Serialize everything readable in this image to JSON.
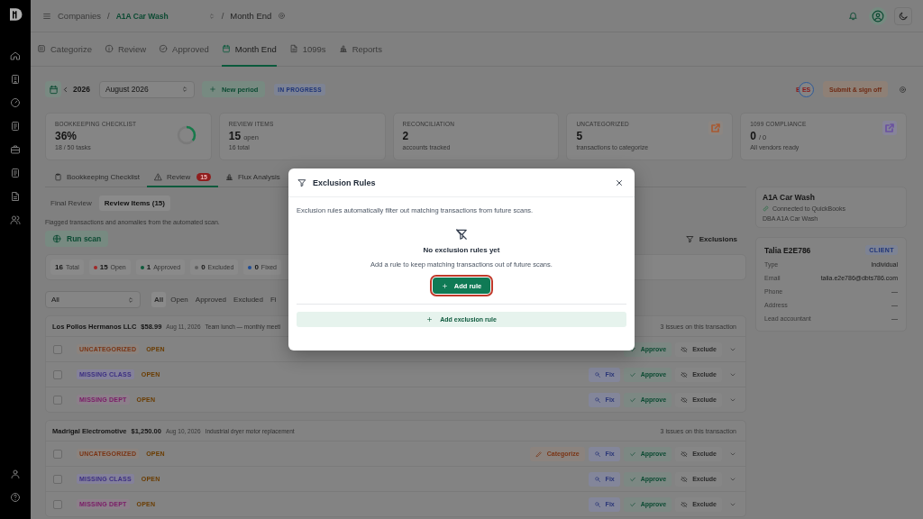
{
  "breadcrumb": [
    {
      "text": "Companies",
      "kind": "link"
    },
    {
      "text": "/",
      "kind": "sep"
    },
    {
      "text": "A1A Car Wash",
      "kind": "company"
    },
    {
      "text": "/",
      "kind": "sep"
    },
    {
      "text": "Month End",
      "kind": "page"
    }
  ],
  "tabs": [
    {
      "label": "Categorize",
      "kind": "categorize",
      "selected": false
    },
    {
      "label": "Review",
      "kind": "review",
      "selected": false
    },
    {
      "label": "Approved",
      "kind": "approved",
      "selected": false
    },
    {
      "label": "Month End",
      "kind": "calendar",
      "selected": true
    },
    {
      "label": "1099s",
      "kind": "file",
      "selected": false
    },
    {
      "label": "Reports",
      "kind": "chart",
      "selected": false
    }
  ],
  "period": {
    "year": "2026",
    "month": "August 2026",
    "new_button": "New period",
    "status": "IN PROGRESS"
  },
  "signoff": {
    "avatars": [
      "E",
      "ES"
    ],
    "button": "Submit & sign off"
  },
  "stats": [
    {
      "label": "BOOKKEEPING CHECKLIST",
      "value": "36%",
      "sub": "18 / 50 tasks",
      "kind": "ring",
      "level": 0.36
    },
    {
      "label": "REVIEW ITEMS",
      "value": "15",
      "unit": "open",
      "sub": "16 total",
      "kind": "plain"
    },
    {
      "label": "RECONCILIATION",
      "value": "2",
      "sub": "accounts tracked",
      "kind": "plain"
    },
    {
      "label": "UNCATEGORIZED",
      "value": "5",
      "sub": "transactions to categorize",
      "kind": "link",
      "color": "#a85a32"
    },
    {
      "label": "1099 COMPLIANCE",
      "value": "0",
      "unit": "/ 0",
      "sub": "All vendors ready",
      "kind": "link",
      "color": "#6a52a0"
    }
  ],
  "subtabs": [
    {
      "label": "Bookkeeping Checklist",
      "kind": "checklist",
      "selected": false
    },
    {
      "label": "Review",
      "kind": "review",
      "badge": "15",
      "selected": true
    },
    {
      "label": "Flux Analysis",
      "kind": "flux",
      "selected": false
    }
  ],
  "segments": [
    {
      "label": "Final Review",
      "selected": false
    },
    {
      "label": "Review Items (15)",
      "selected": true
    }
  ],
  "caption": "Flagged transactions and anomalies from the automated scan.",
  "run_scan": "Run scan",
  "exclusions": "Exclusions",
  "counts": [
    {
      "value": "16",
      "label": "Total"
    },
    {
      "value": "15",
      "label": "Open",
      "color": "#a02828"
    },
    {
      "value": "1",
      "label": "Approved",
      "color": "#0e5a3c"
    },
    {
      "value": "0",
      "label": "Excluded",
      "color": "#606060"
    },
    {
      "value": "0",
      "label": "Fixed",
      "color": "#1f4c94"
    }
  ],
  "filter": {
    "select": "All",
    "tabs": [
      {
        "label": "All",
        "selected": true
      },
      {
        "label": "Open",
        "selected": false
      },
      {
        "label": "Approved",
        "selected": false
      },
      {
        "label": "Excluded",
        "selected": false
      },
      {
        "label": "Fi",
        "selected": false
      }
    ]
  },
  "groups": [
    {
      "vendor": "Los Pollos Hermanos LLC",
      "amount": "$58.99",
      "date": "Aug 11, 2026",
      "memo": "Team lunch — monthly meeti",
      "issues": "3 issues on this transaction",
      "rows": [
        {
          "checked": false,
          "tag": "UNCATEGORIZED",
          "kind": "uncategorized",
          "status": "OPEN",
          "actions": [
            {
              "kind": "approve",
              "label": "Approve"
            },
            {
              "kind": "exclude",
              "label": "Exclude"
            }
          ]
        },
        {
          "checked": false,
          "tag": "MISSING CLASS",
          "kind": "class",
          "status": "OPEN",
          "actions": [
            {
              "kind": "fix",
              "label": "Fix"
            },
            {
              "kind": "approve",
              "label": "Approve"
            },
            {
              "kind": "exclude",
              "label": "Exclude"
            }
          ]
        },
        {
          "checked": false,
          "tag": "MISSING DEPT",
          "kind": "dept",
          "status": "OPEN",
          "actions": [
            {
              "kind": "fix",
              "label": "Fix"
            },
            {
              "kind": "approve",
              "label": "Approve"
            },
            {
              "kind": "exclude",
              "label": "Exclude"
            }
          ]
        }
      ]
    },
    {
      "vendor": "Madrigal Electromotive",
      "amount": "$1,250.00",
      "date": "Aug 10, 2026",
      "memo": "Industrial dryer motor replacement",
      "issues": "3 issues on this transaction",
      "rows": [
        {
          "checked": false,
          "tag": "UNCATEGORIZED",
          "kind": "uncategorized",
          "status": "OPEN",
          "actions": [
            {
              "kind": "categorize",
              "label": "Categorize"
            },
            {
              "kind": "fix",
              "label": "Fix"
            },
            {
              "kind": "approve",
              "label": "Approve"
            },
            {
              "kind": "exclude",
              "label": "Exclude"
            }
          ]
        },
        {
          "checked": false,
          "tag": "MISSING CLASS",
          "kind": "class",
          "status": "OPEN",
          "actions": [
            {
              "kind": "fix",
              "label": "Fix"
            },
            {
              "kind": "approve",
              "label": "Approve"
            },
            {
              "kind": "exclude",
              "label": "Exclude"
            }
          ]
        },
        {
          "checked": false,
          "tag": "MISSING DEPT",
          "kind": "dept",
          "status": "OPEN",
          "actions": [
            {
              "kind": "fix",
              "label": "Fix"
            },
            {
              "kind": "approve",
              "label": "Approve"
            },
            {
              "kind": "exclude",
              "label": "Exclude"
            }
          ]
        }
      ]
    }
  ],
  "client": {
    "company": {
      "name": "A1A Car Wash",
      "connection": "Connected to QuickBooks",
      "dba": "DBA A1A Car Wash"
    },
    "contact": {
      "name": "Talia E2E786",
      "badge": "CLIENT",
      "fields": [
        {
          "label": "Type",
          "value": "Individual"
        },
        {
          "label": "Email",
          "value": "talia.e2e786@dbts786.com"
        },
        {
          "label": "Phone",
          "value": "—"
        },
        {
          "label": "Address",
          "value": "—"
        },
        {
          "label": "Lead accountant",
          "value": "—"
        }
      ]
    }
  },
  "modal": {
    "title": "Exclusion Rules",
    "description": "Exclusion rules automatically filter out matching transactions from future scans.",
    "empty_title": "No exclusion rules yet",
    "empty_text": "Add a rule to keep matching transactions out of future scans.",
    "primary": {
      "label": "Add rule",
      "focused": true
    },
    "footer_button": "Add exclusion rule"
  }
}
